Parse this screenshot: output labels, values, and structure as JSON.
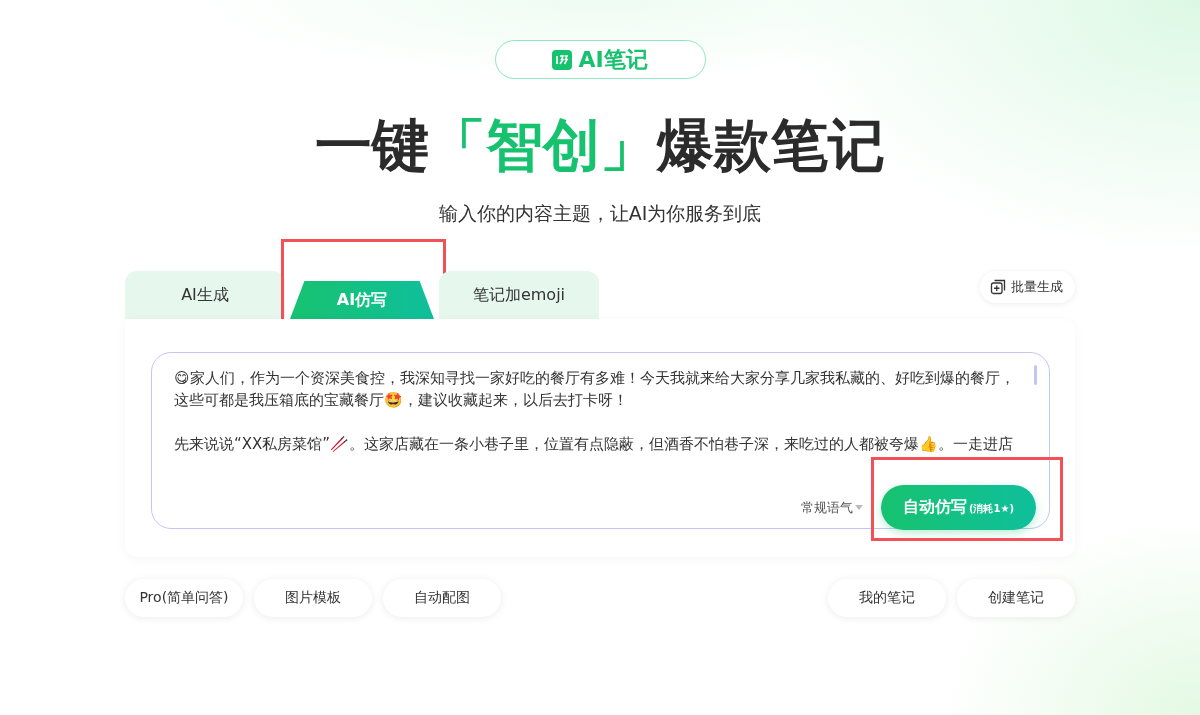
{
  "logo": {
    "text": "AI笔记"
  },
  "headline": {
    "before": "一键",
    "highlight": "「智创」",
    "after": "爆款笔记"
  },
  "subtitle": "输入你的内容主题，让AI为你服务到底",
  "tabs": [
    {
      "label": "AI生成",
      "selected": false,
      "highlighted": false
    },
    {
      "label": "AI仿写",
      "selected": true,
      "highlighted": true
    },
    {
      "label": "笔记加emoji",
      "selected": false,
      "highlighted": false
    }
  ],
  "batch_button": "批量生成",
  "editor": {
    "paragraphs": [
      "😋家人们，作为一个资深美食控，我深知寻找一家好吃的餐厅有多难！今天我就来给大家分享几家我私藏的、好吃到爆的餐厅，这些可都是我压箱底的宝藏餐厅🤩，建议收藏起来，以后去打卡呀！",
      "先来说说“XX私房菜馆”🥢。这家店藏在一条小巷子里，位置有点隐蔽，但酒香不怕巷子深，来吃过的人都被夸爆👍。一走进店"
    ],
    "tone": "常规语气",
    "submit": {
      "label": "自动仿写",
      "cost": "(消耗1★)",
      "highlighted": true
    }
  },
  "bottom_left": [
    "Pro(简单问答)",
    "图片模板",
    "自动配图"
  ],
  "bottom_right": [
    "我的笔记",
    "创建笔记"
  ]
}
